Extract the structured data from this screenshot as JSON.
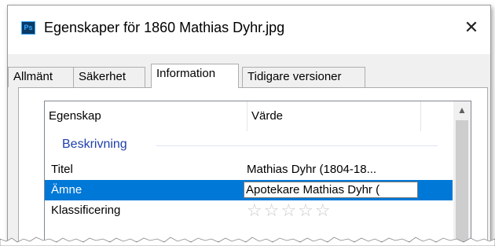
{
  "window": {
    "app_icon_text": "Ps",
    "title": "Egenskaper för 1860 Mathias Dyhr.jpg",
    "close_glyph": "✕"
  },
  "tabs": [
    {
      "label": "Allmänt"
    },
    {
      "label": "Säkerhet"
    },
    {
      "label": "Information",
      "active": true
    },
    {
      "label": "Tidigare versioner"
    }
  ],
  "list": {
    "columns": {
      "property": "Egenskap",
      "value": "Värde"
    },
    "group_label": "Beskrivning",
    "rows": [
      {
        "name": "Titel",
        "value": "Mathias Dyhr (1804-18..."
      },
      {
        "name": "Ämne",
        "value": "Apotekare Mathias Dyhr (",
        "selected": true,
        "editing": true
      },
      {
        "name": "Klassificering",
        "value": "☆☆☆☆☆",
        "rating": 0,
        "rating_max": 5
      }
    ]
  },
  "colors": {
    "selection": "#0078d7",
    "group_label": "#1e3faa",
    "ps_icon_bg": "#0b3a66",
    "ps_icon_fg": "#31a8ff"
  }
}
